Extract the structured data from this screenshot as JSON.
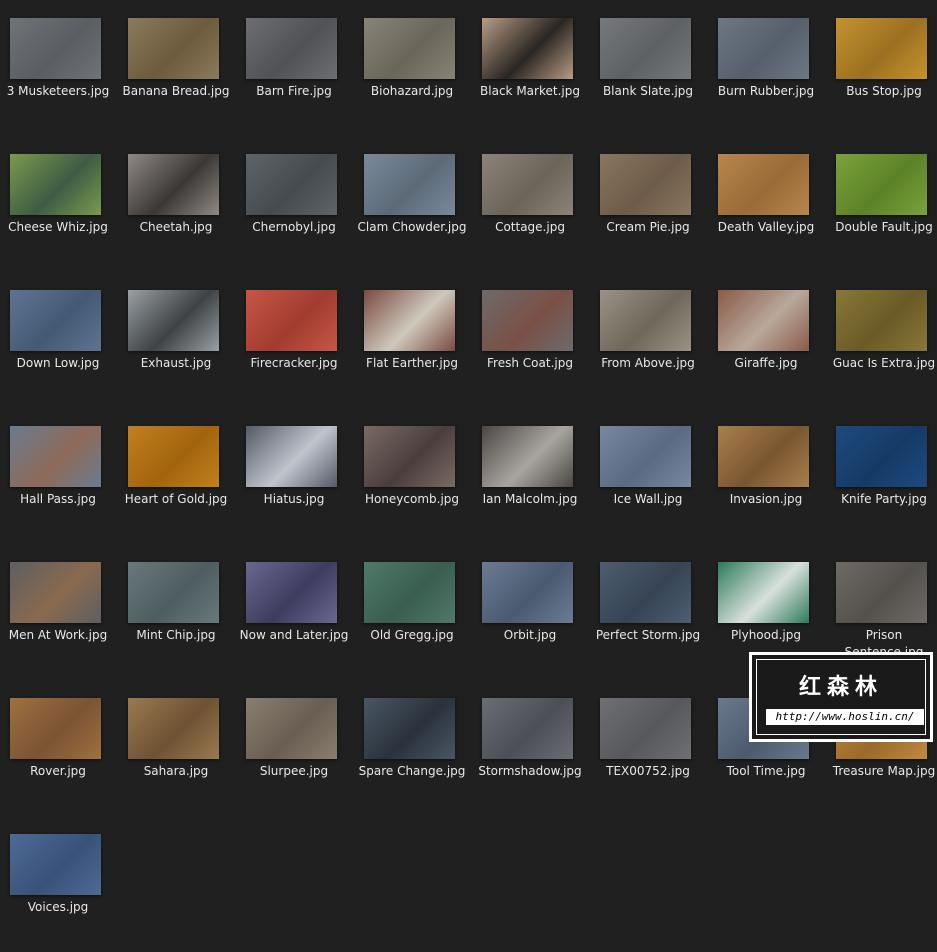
{
  "files": [
    {
      "name": "3 Musketeers.jpg",
      "colors": [
        "#707479",
        "#5a5e63"
      ]
    },
    {
      "name": "Banana Bread.jpg",
      "colors": [
        "#8b7a5c",
        "#6d5b3d"
      ]
    },
    {
      "name": "Barn Fire.jpg",
      "colors": [
        "#6c6e72",
        "#505256"
      ]
    },
    {
      "name": "Biohazard.jpg",
      "colors": [
        "#878477",
        "#6a675a"
      ]
    },
    {
      "name": "Black Market.jpg",
      "colors": [
        "#b89c85",
        "#2a2622"
      ]
    },
    {
      "name": "Blank Slate.jpg",
      "colors": [
        "#76797c",
        "#5e6164"
      ]
    },
    {
      "name": "Burn Rubber.jpg",
      "colors": [
        "#6e7884",
        "#565f6b"
      ]
    },
    {
      "name": "Bus Stop.jpg",
      "colors": [
        "#c4932f",
        "#9c7020"
      ]
    },
    {
      "name": "Cheese Whiz.jpg",
      "colors": [
        "#7a9a4e",
        "#3e5c44"
      ]
    },
    {
      "name": "Cheetah.jpg",
      "colors": [
        "#8f8a86",
        "#3b3734"
      ]
    },
    {
      "name": "Chernobyl.jpg",
      "colors": [
        "#5e6468",
        "#464b4f"
      ]
    },
    {
      "name": "Clam Chowder.jpg",
      "colors": [
        "#7a8a9a",
        "#5c6a78"
      ]
    },
    {
      "name": "Cottage.jpg",
      "colors": [
        "#8c8478",
        "#6b6458"
      ]
    },
    {
      "name": "Cream Pie.jpg",
      "colors": [
        "#8a7660",
        "#6d5c49"
      ]
    },
    {
      "name": "Death Valley.jpg",
      "colors": [
        "#b8864e",
        "#9a6b38"
      ]
    },
    {
      "name": "Double Fault.jpg",
      "colors": [
        "#7aa23a",
        "#5c8228"
      ]
    },
    {
      "name": "Down Low.jpg",
      "colors": [
        "#5e7490",
        "#445a74"
      ]
    },
    {
      "name": "Exhaust.jpg",
      "colors": [
        "#9aa0a4",
        "#3e4245"
      ]
    },
    {
      "name": "Firecracker.jpg",
      "colors": [
        "#c85646",
        "#a03c30"
      ]
    },
    {
      "name": "Flat Earther.jpg",
      "colors": [
        "#7a4a40",
        "#cfc8bc"
      ]
    },
    {
      "name": "Fresh Coat.jpg",
      "colors": [
        "#6e6a6a",
        "#7a5046"
      ]
    },
    {
      "name": "From Above.jpg",
      "colors": [
        "#9a9284",
        "#6f675a"
      ]
    },
    {
      "name": "Giraffe.jpg",
      "colors": [
        "#8a5a48",
        "#b8a89a"
      ]
    },
    {
      "name": "Guac Is Extra.jpg",
      "colors": [
        "#8a7838",
        "#6a5a26"
      ]
    },
    {
      "name": "Hall Pass.jpg",
      "colors": [
        "#6a7c90",
        "#8e6a58"
      ]
    },
    {
      "name": "Heart of Gold.jpg",
      "colors": [
        "#c2801e",
        "#a2640e"
      ]
    },
    {
      "name": "Hiatus.jpg",
      "colors": [
        "#545a66",
        "#c0c4cc"
      ]
    },
    {
      "name": "Honeycomb.jpg",
      "colors": [
        "#7a6a66",
        "#4a3e3c"
      ]
    },
    {
      "name": "Ian Malcolm.jpg",
      "colors": [
        "#4a4644",
        "#a8a49e"
      ]
    },
    {
      "name": "Ice Wall.jpg",
      "colors": [
        "#7888a0",
        "#5a6a82"
      ]
    },
    {
      "name": "Invasion.jpg",
      "colors": [
        "#a8804e",
        "#7a5630"
      ]
    },
    {
      "name": "Knife Party.jpg",
      "colors": [
        "#1e4a80",
        "#163a66"
      ]
    },
    {
      "name": "Men At Work.jpg",
      "colors": [
        "#5e5e62",
        "#8a6a4e"
      ]
    },
    {
      "name": "Mint Chip.jpg",
      "colors": [
        "#6a7a7c",
        "#4e5e60"
      ]
    },
    {
      "name": "Now and Later.jpg",
      "colors": [
        "#6a6890",
        "#3e3c5e"
      ]
    },
    {
      "name": "Old Gregg.jpg",
      "colors": [
        "#4e7a6a",
        "#3a5e50"
      ]
    },
    {
      "name": "Orbit.jpg",
      "colors": [
        "#6a7c94",
        "#4a5a70"
      ]
    },
    {
      "name": "Perfect Storm.jpg",
      "colors": [
        "#4e5e70",
        "#364454"
      ]
    },
    {
      "name": "Plyhood.jpg",
      "colors": [
        "#2e7a5a",
        "#d8e0dc"
      ]
    },
    {
      "name": "Prison Sentence.jpg",
      "colors": [
        "#6e6a66",
        "#54504c"
      ]
    },
    {
      "name": "Rover.jpg",
      "colors": [
        "#a07040",
        "#7a5434"
      ]
    },
    {
      "name": "Sahara.jpg",
      "colors": [
        "#9a7a50",
        "#6e5234"
      ]
    },
    {
      "name": "Slurpee.jpg",
      "colors": [
        "#8a7e70",
        "#6a5e52"
      ]
    },
    {
      "name": "Spare Change.jpg",
      "colors": [
        "#4a5664",
        "#2a323c"
      ]
    },
    {
      "name": "Stormshadow.jpg",
      "colors": [
        "#6a6e74",
        "#4c5056"
      ]
    },
    {
      "name": "TEX00752.jpg",
      "colors": [
        "#6e7074",
        "#56585c"
      ]
    },
    {
      "name": "Tool Time.jpg",
      "colors": [
        "#6a7a8e",
        "#4c5a6c"
      ]
    },
    {
      "name": "Treasure Map.jpg",
      "colors": [
        "#c08a40",
        "#9a6a28"
      ]
    },
    {
      "name": "Voices.jpg",
      "colors": [
        "#4e6a96",
        "#3a5278"
      ]
    }
  ],
  "watermark": {
    "cn_text": "红森林",
    "url": "http://www.hoslin.cn/"
  }
}
